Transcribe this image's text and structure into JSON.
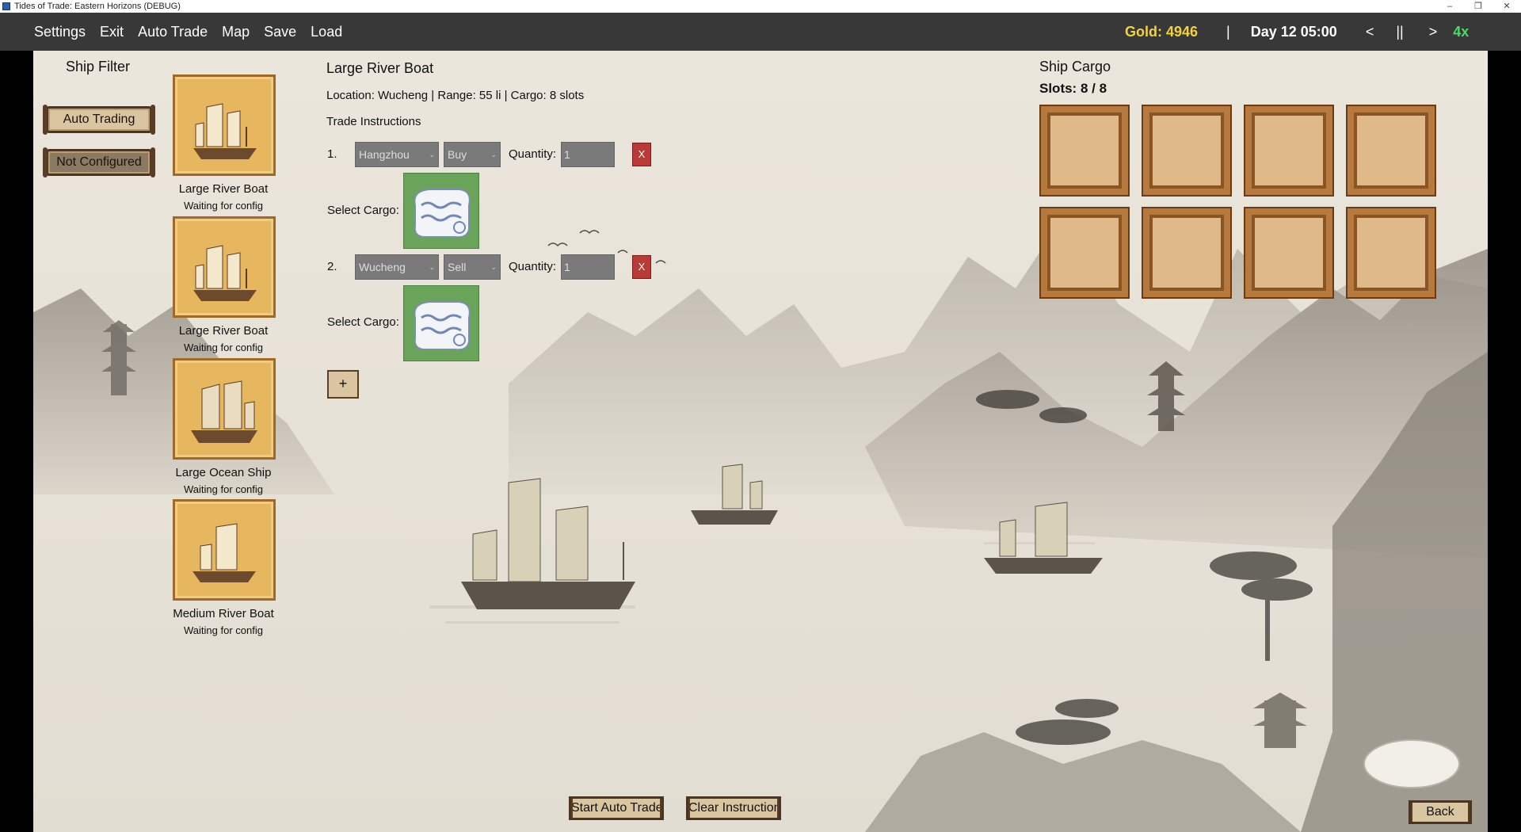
{
  "window": {
    "title": "Tides of Trade: Eastern Horizons (DEBUG)",
    "controls": [
      "–",
      "❐",
      "✕"
    ]
  },
  "menu": {
    "items": [
      "Settings",
      "Exit",
      "Auto Trade",
      "Map",
      "Save",
      "Load"
    ]
  },
  "status": {
    "gold": "Gold: 4946",
    "separator": "|",
    "day": "Day 12 05:00",
    "prev": "<",
    "pause": "||",
    "next": ">",
    "speed": "4x"
  },
  "ship_filter": {
    "title": "Ship Filter",
    "auto_trading_label": "Auto Trading",
    "not_configured_label": "Not Configured",
    "ships": [
      {
        "name": "Large River Boat",
        "status": "Waiting for config",
        "icon": "junk-ship-icon"
      },
      {
        "name": "Large River Boat",
        "status": "Waiting for config",
        "icon": "junk-ship-icon"
      },
      {
        "name": "Large Ocean Ship",
        "status": "Waiting for config",
        "icon": "ocean-ship-icon"
      },
      {
        "name": "Medium River Boat",
        "status": "Waiting for config",
        "icon": "river-boat-icon"
      }
    ]
  },
  "selected_ship": {
    "title": "Large River Boat",
    "info": "Location: Wucheng | Range: 55 li | Cargo: 8 slots",
    "instructions_title": "Trade Instructions",
    "quantity_label": "Quantity:",
    "select_cargo_label": "Select Cargo:",
    "delete_label": "X",
    "add_label": "+",
    "instructions": [
      {
        "num": "1.",
        "city": "Hangzhou",
        "action": "Buy",
        "quantity": "1",
        "cargo_icon": "silk-cloth-icon"
      },
      {
        "num": "2.",
        "city": "Wucheng",
        "action": "Sell",
        "quantity": "1",
        "cargo_icon": "silk-cloth-icon"
      }
    ]
  },
  "ship_cargo": {
    "title": "Ship Cargo",
    "slots_label": "Slots: 8 / 8",
    "slot_count": 8
  },
  "actions": {
    "start": "Start Auto Trade",
    "clear": "Clear Instructions",
    "back": "Back"
  }
}
